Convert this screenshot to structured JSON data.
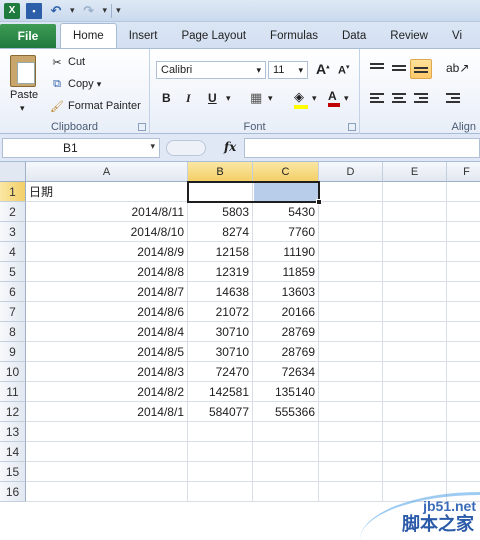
{
  "titlebar": {
    "undo_arrow": "↶",
    "redo_arrow": "↷",
    "dropdown_arrow": "▾",
    "excel_letter": "X"
  },
  "tabs": [
    {
      "label": "File"
    },
    {
      "label": "Home"
    },
    {
      "label": "Insert"
    },
    {
      "label": "Page Layout"
    },
    {
      "label": "Formulas"
    },
    {
      "label": "Data"
    },
    {
      "label": "Review"
    },
    {
      "label": "Vi"
    }
  ],
  "ribbon": {
    "clipboard": {
      "label": "Clipboard",
      "paste": "Paste",
      "cut": "Cut",
      "copy": "Copy",
      "format_painter": "Format Painter"
    },
    "font": {
      "label": "Font",
      "name": "Calibri",
      "size": "11",
      "bold": "B",
      "italic": "I",
      "underline": "U",
      "grow": "A",
      "shrink": "A",
      "font_color": "A",
      "fill_color": "#ffff00",
      "text_color": "#c00000"
    },
    "alignment": {
      "label": "Align"
    }
  },
  "formula_bar": {
    "name_box": "B1",
    "fx": "fx",
    "value": ""
  },
  "columns": [
    "A",
    "B",
    "C",
    "D",
    "E",
    "F"
  ],
  "rows": [
    {
      "num": "1",
      "a": "日期",
      "b": "",
      "c": ""
    },
    {
      "num": "2",
      "a": "2014/8/11",
      "b": "5803",
      "c": "5430"
    },
    {
      "num": "3",
      "a": "2014/8/10",
      "b": "8274",
      "c": "7760"
    },
    {
      "num": "4",
      "a": "2014/8/9",
      "b": "12158",
      "c": "11190"
    },
    {
      "num": "5",
      "a": "2014/8/8",
      "b": "12319",
      "c": "11859"
    },
    {
      "num": "6",
      "a": "2014/8/7",
      "b": "14638",
      "c": "13603"
    },
    {
      "num": "7",
      "a": "2014/8/6",
      "b": "21072",
      "c": "20166"
    },
    {
      "num": "8",
      "a": "2014/8/4",
      "b": "30710",
      "c": "28769"
    },
    {
      "num": "9",
      "a": "2014/8/5",
      "b": "30710",
      "c": "28769"
    },
    {
      "num": "10",
      "a": "2014/8/3",
      "b": "72470",
      "c": "72634"
    },
    {
      "num": "11",
      "a": "2014/8/2",
      "b": "142581",
      "c": "135140"
    },
    {
      "num": "12",
      "a": "2014/8/1",
      "b": "584077",
      "c": "555366"
    },
    {
      "num": "13",
      "a": "",
      "b": "",
      "c": ""
    },
    {
      "num": "14",
      "a": "",
      "b": "",
      "c": ""
    },
    {
      "num": "15",
      "a": "",
      "b": "",
      "c": ""
    },
    {
      "num": "16",
      "a": "",
      "b": "",
      "c": ""
    }
  ],
  "watermark": {
    "site": "jb51.net",
    "name": "脚本之家"
  }
}
